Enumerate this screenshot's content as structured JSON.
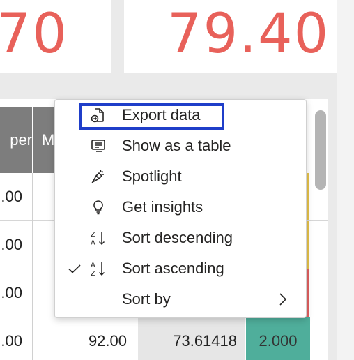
{
  "kpis": {
    "left_value": ".70",
    "right_value": "79.40",
    "color": "#e8615a"
  },
  "table": {
    "headers": [
      "per",
      "M"
    ],
    "rows": [
      {
        "c1": ".00",
        "num": "",
        "dec": "",
        "badge": "",
        "accent": "#e5c14a"
      },
      {
        "c1": ".00",
        "num": "",
        "dec": "",
        "badge": "",
        "accent": "#e5c14a"
      },
      {
        "c1": ".00",
        "num": "",
        "dec": "",
        "badge": "",
        "accent": "#e06060"
      },
      {
        "c1": ".00",
        "num": "92.00",
        "dec": "73.61418",
        "badge": "2.000",
        "accent": "#4fae9b"
      }
    ]
  },
  "context_menu": {
    "items": [
      {
        "label": "Export data",
        "icon": "export-icon",
        "highlighted": true
      },
      {
        "label": "Show as a table",
        "icon": "table-view-icon"
      },
      {
        "label": "Spotlight",
        "icon": "spotlight-icon"
      },
      {
        "label": "Get insights",
        "icon": "lightbulb-icon"
      },
      {
        "label": "Sort descending",
        "icon": "sort-descending-icon"
      },
      {
        "label": "Sort ascending",
        "icon": "sort-ascending-icon",
        "checked": true
      },
      {
        "label": "Sort by",
        "icon": "",
        "submenu": true
      }
    ],
    "highlight_color": "#1f3ec9"
  }
}
